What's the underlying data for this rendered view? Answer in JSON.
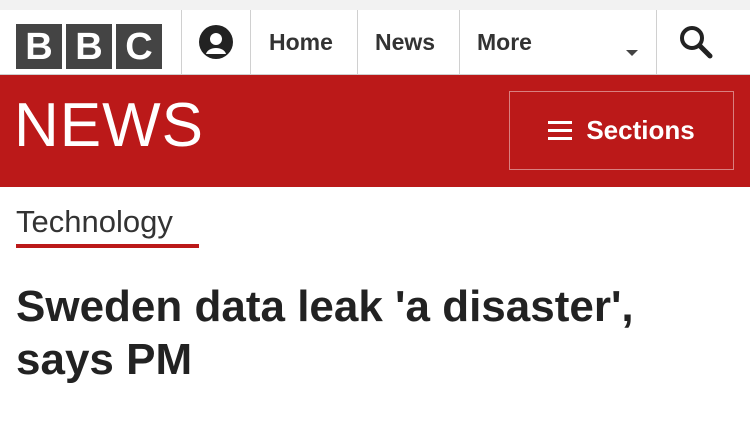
{
  "header": {
    "logo_letters": [
      "B",
      "B",
      "C"
    ],
    "account_icon": "user-icon",
    "nav": [
      {
        "label": "Home"
      },
      {
        "label": "News"
      },
      {
        "label": "More"
      }
    ],
    "search_icon": "search-icon"
  },
  "news_bar": {
    "logo": "NEWS",
    "sections_label": "Sections",
    "sections_icon": "hamburger-icon",
    "color": "#bb1919"
  },
  "article": {
    "section": "Technology",
    "headline": "Sweden data leak 'a disaster', says PM"
  }
}
